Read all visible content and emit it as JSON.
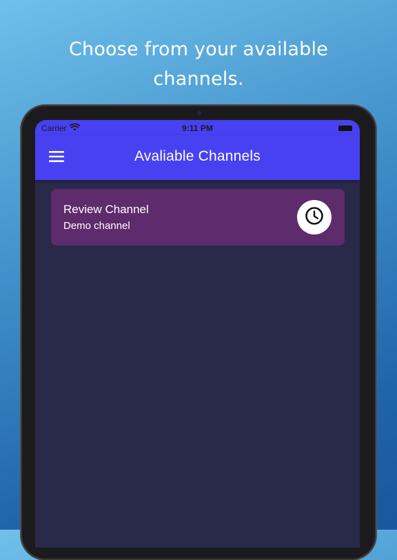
{
  "promo": {
    "line1": "Choose from your available",
    "line2": "channels."
  },
  "status_bar": {
    "carrier": "Carrier",
    "time": "9:11 PM"
  },
  "app_bar": {
    "title": "Avaliable Channels",
    "menu_icon": "hamburger-menu-icon"
  },
  "channels": [
    {
      "name": "Review Channel",
      "description": "Demo channel",
      "action_icon": "clock-icon"
    }
  ],
  "colors": {
    "app_bar": "#4841f2",
    "screen_background": "#29294a",
    "card_background": "#5e2b6c",
    "page_gradient_start": "#6fc0ea",
    "page_gradient_end": "#1a579c"
  }
}
